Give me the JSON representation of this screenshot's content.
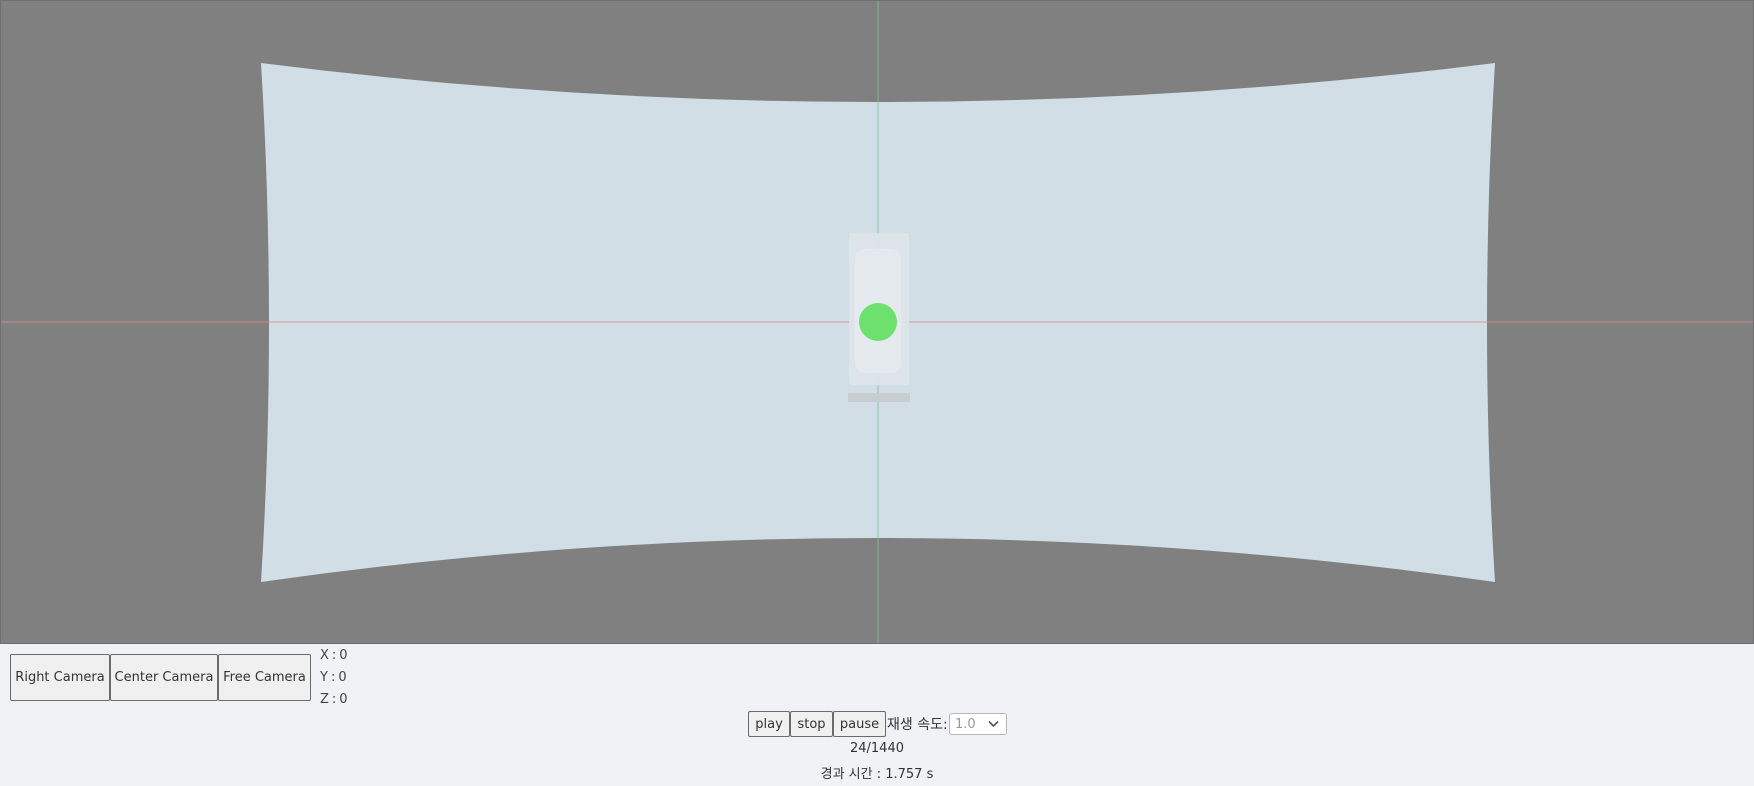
{
  "camera_buttons": {
    "right": "Right Camera",
    "center": "Center Camera",
    "free": "Free Camera"
  },
  "coordinates": {
    "x_label": "X",
    "x_value": "0",
    "y_label": "Y",
    "y_value": "0",
    "z_label": "Z",
    "z_value": "0",
    "separator": ":"
  },
  "playback": {
    "play": "play",
    "stop": "stop",
    "pause": "pause",
    "speed_label": "재생 속도:",
    "speed_value": "1.0",
    "frame_counter": "24/1440",
    "elapsed_time": "경과 시간 : 1.757 s"
  },
  "scene": {
    "background_color": "#808080",
    "screen_color": "#d1dee5",
    "marker_color": "#6de06d",
    "x_axis_color": "#d98a8a",
    "y_axis_color": "#7fbf9c"
  }
}
